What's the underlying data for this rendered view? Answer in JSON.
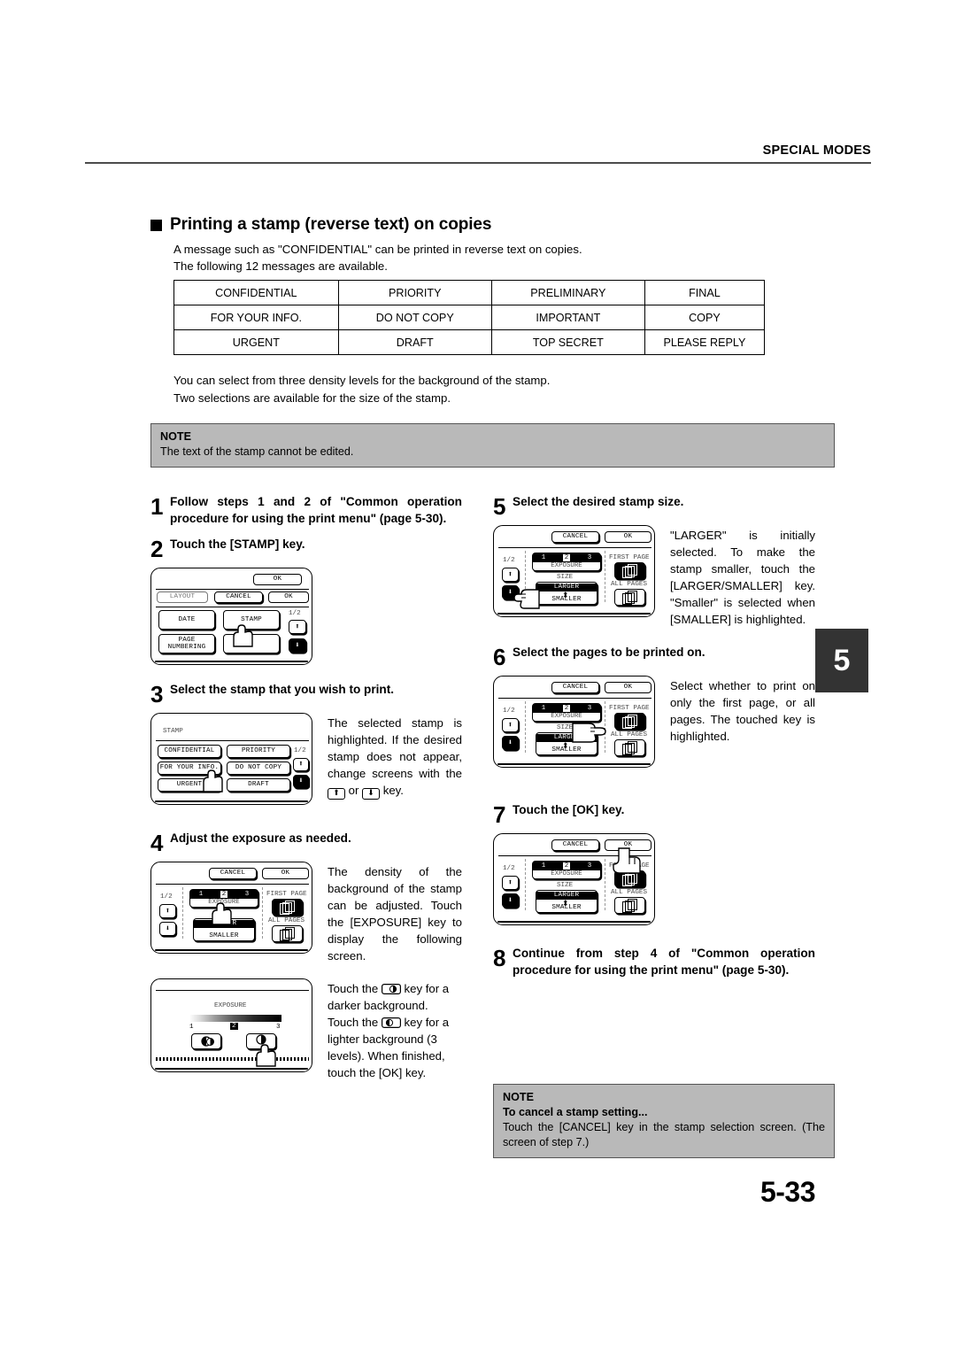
{
  "header": {
    "title": "SPECIAL MODES"
  },
  "section": {
    "title": "Printing a stamp (reverse text) on copies",
    "intro_line1": "A message such as \"CONFIDENTIAL\" can be printed in reverse text on copies.",
    "intro_line2": "The following 12 messages are available.",
    "after_line1": "You can select from three density levels for the background of the stamp.",
    "after_line2": "Two selections are available for the size of the stamp."
  },
  "stamp_table": {
    "rows": [
      [
        "CONFIDENTIAL",
        "PRIORITY",
        "PRELIMINARY",
        "FINAL"
      ],
      [
        "FOR YOUR INFO.",
        "DO NOT COPY",
        "IMPORTANT",
        "COPY"
      ],
      [
        "URGENT",
        "DRAFT",
        "TOP SECRET",
        "PLEASE REPLY"
      ]
    ]
  },
  "note_top": {
    "title": "NOTE",
    "body": "The text of the stamp cannot be edited."
  },
  "note_bottom": {
    "title": "NOTE",
    "subtitle": "To cancel a stamp setting...",
    "body": "Touch the [CANCEL] key in the stamp selection screen. (The screen of step 7.)"
  },
  "steps": {
    "s1": {
      "num": "1",
      "text": "Follow steps 1 and 2 of \"Common operation procedure for using the print menu\" (page 5-30)."
    },
    "s2": {
      "num": "2",
      "text": "Touch the [STAMP] key."
    },
    "s3": {
      "num": "3",
      "text": "Select the stamp that you wish to print.",
      "body_a": "The selected stamp is highlighted. If the desired stamp does not appear, change screens with the",
      "body_b": "or",
      "body_c": "key."
    },
    "s4": {
      "num": "4",
      "text": "Adjust the exposure as needed.",
      "body": "The density of the background of the stamp can be adjusted. Touch the [EXPOSURE] key to display the following screen.",
      "body2_a": "Touch the",
      "body2_b": "key for a darker background. Touch the",
      "body2_c": "key for a lighter background (3 levels).",
      "body2_d": "When finished, touch the [OK] key."
    },
    "s5": {
      "num": "5",
      "text": "Select the desired stamp size.",
      "body": "\"LARGER\" is initially selected. To make the stamp smaller, touch the [LARGER/SMALLER] key. \"Smaller\" is selected when [SMALLER] is highlighted."
    },
    "s6": {
      "num": "6",
      "text": "Select the pages to be printed on.",
      "body": "Select whether to print on only the first page, or all pages. The touched key is highlighted."
    },
    "s7": {
      "num": "7",
      "text": "Touch the [OK] key."
    },
    "s8": {
      "num": "8",
      "text": "Continue from step 4 of \"Common operation procedure for using the print menu\" (page 5-30)."
    }
  },
  "panels": {
    "print_menu": {
      "ok_top": "OK",
      "layout": "LAYOUT",
      "cancel": "CANCEL",
      "ok": "OK",
      "date": "DATE",
      "stamp": "STAMP",
      "page_numbering": "PAGE NUMBERING",
      "page_indicator": "1/2"
    },
    "stamp_select": {
      "title": "STAMP",
      "keys": [
        "CONFIDENTIAL",
        "PRIORITY",
        "FOR YOUR INFO.",
        "DO NOT COPY",
        "URGENT",
        "DRAFT"
      ],
      "page_indicator": "1/2"
    },
    "stamp_settings": {
      "cancel": "CANCEL",
      "ok": "OK",
      "page_indicator": "1/2",
      "exposure_levels": [
        "1",
        "2",
        "3"
      ],
      "exposure_selected": "2",
      "exposure_label": "EXPOSURE",
      "size_label": "SIZE",
      "larger": "LARGER",
      "smaller": "SMALLER",
      "first_page": "FIRST PAGE",
      "all_pages": "ALL PAGES"
    },
    "exposure_dialog": {
      "title": "EXPOSURE",
      "scale_min": "1",
      "scale_selected": "2",
      "scale_max": "3"
    }
  },
  "chapter_tab": "5",
  "page_number": "5-33"
}
